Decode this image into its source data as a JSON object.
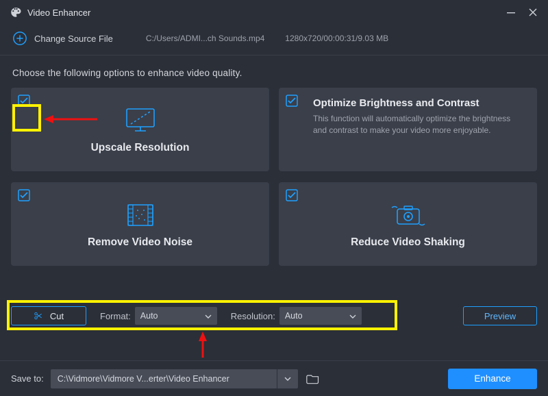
{
  "window": {
    "title": "Video Enhancer"
  },
  "source": {
    "change_label": "Change Source File",
    "path": "C:/Users/ADMI...ch Sounds.mp4",
    "meta": "1280x720/00:00:31/9.03 MB"
  },
  "instruction": "Choose the following options to enhance video quality.",
  "cards": {
    "upscale": {
      "title": "Upscale Resolution"
    },
    "brightness": {
      "title": "Optimize Brightness and Contrast",
      "desc": "This function will automatically optimize the brightness and contrast to make your video more enjoyable."
    },
    "noise": {
      "title": "Remove Video Noise"
    },
    "shaking": {
      "title": "Reduce Video Shaking"
    }
  },
  "controls": {
    "cut_label": "Cut",
    "format_label": "Format:",
    "format_value": "Auto",
    "resolution_label": "Resolution:",
    "resolution_value": "Auto",
    "preview_label": "Preview"
  },
  "save": {
    "label": "Save to:",
    "path": "C:\\Vidmore\\Vidmore V...erter\\Video Enhancer"
  },
  "enhance_label": "Enhance",
  "colors": {
    "accent": "#1f8fff",
    "annotate_yellow": "#fff200",
    "annotate_red": "#e11"
  }
}
